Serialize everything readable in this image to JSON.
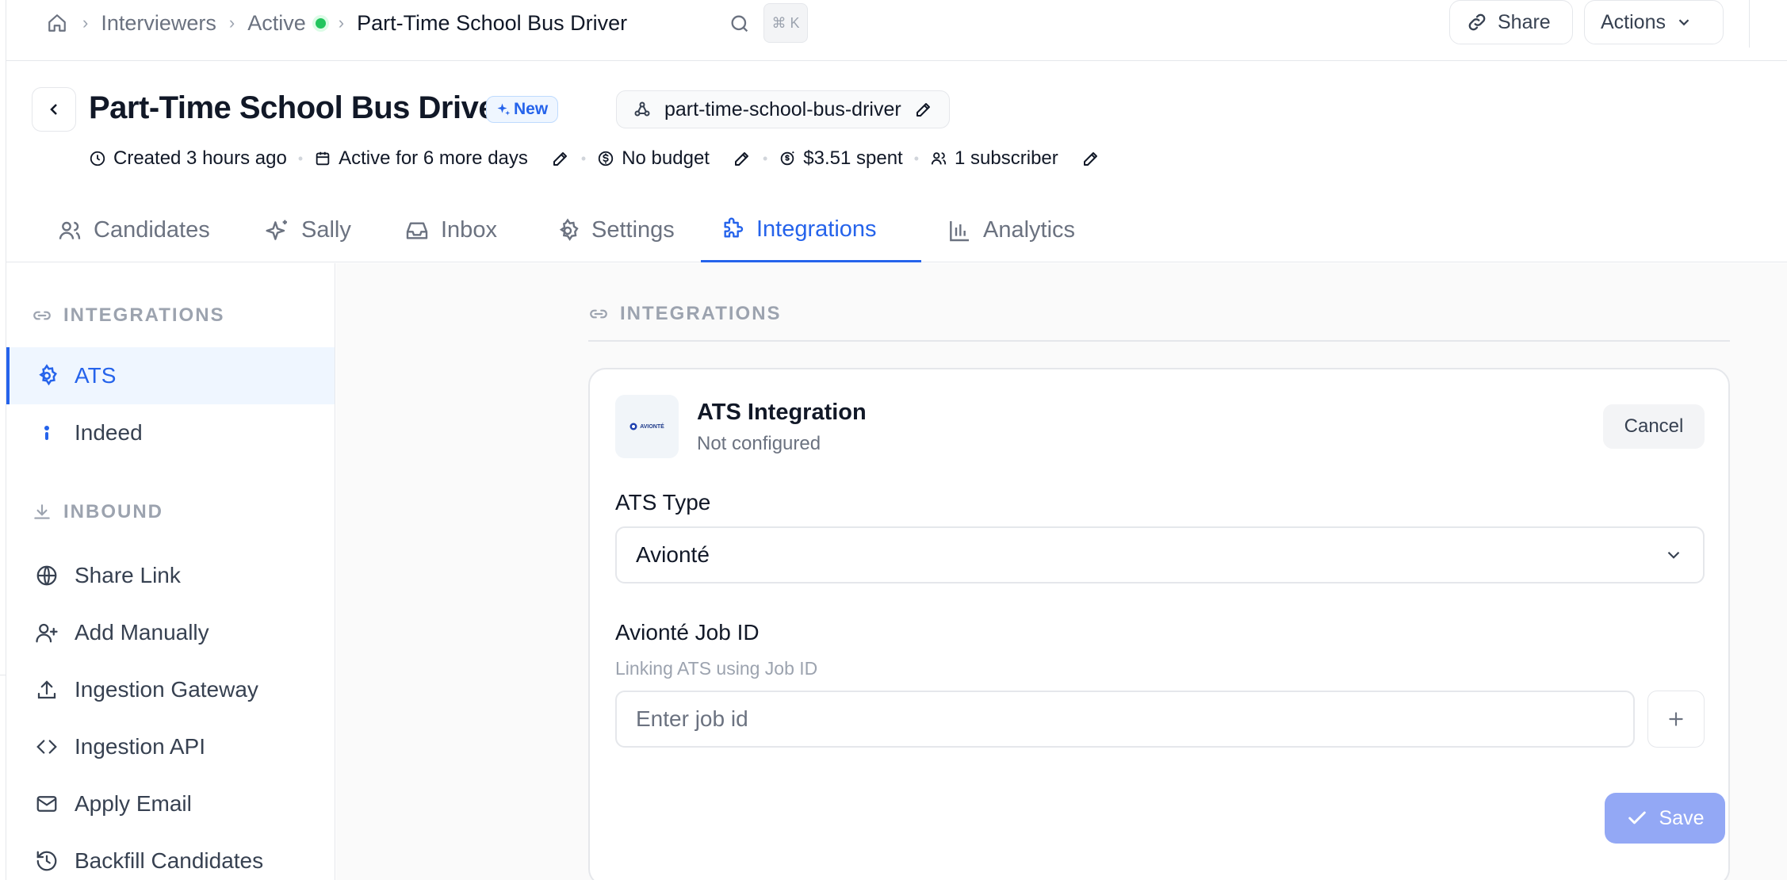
{
  "breadcrumb": {
    "items": [
      "Interviewers",
      "Active"
    ],
    "current": "Part-Time School Bus Driver",
    "shortcut": "⌘ K"
  },
  "topbar": {
    "share_label": "Share",
    "actions_label": "Actions"
  },
  "header": {
    "title": "Part-Time School Bus Driver",
    "badge": "New",
    "slug": "part-time-school-bus-driver",
    "meta": {
      "created": "Created 3 hours ago",
      "active": "Active for 6 more days",
      "budget": "No budget",
      "spent": "$3.51 spent",
      "subscribers": "1 subscriber"
    }
  },
  "tabs": [
    {
      "label": "Candidates",
      "icon": "users-icon"
    },
    {
      "label": "Sally",
      "icon": "sparkles-icon"
    },
    {
      "label": "Inbox",
      "icon": "inbox-icon"
    },
    {
      "label": "Settings",
      "icon": "gear-icon"
    },
    {
      "label": "Integrations",
      "icon": "puzzle-icon",
      "active": true
    },
    {
      "label": "Analytics",
      "icon": "bar-chart-icon"
    }
  ],
  "sidebar": {
    "integrations_heading": "INTEGRATIONS",
    "integrations_items": [
      {
        "label": "ATS",
        "icon": "gear-icon",
        "active": true
      },
      {
        "label": "Indeed",
        "icon": "indeed-icon"
      }
    ],
    "inbound_heading": "INBOUND",
    "inbound_items": [
      {
        "label": "Share Link",
        "icon": "globe-icon"
      },
      {
        "label": "Add Manually",
        "icon": "user-plus-icon"
      },
      {
        "label": "Ingestion Gateway",
        "icon": "upload-icon"
      },
      {
        "label": "Ingestion API",
        "icon": "code-icon"
      },
      {
        "label": "Apply Email",
        "icon": "mail-icon"
      },
      {
        "label": "Backfill Candidates",
        "icon": "history-icon"
      }
    ]
  },
  "main": {
    "section_heading": "INTEGRATIONS",
    "card": {
      "logo_text": "AVIONTÉ",
      "title": "ATS Integration",
      "status": "Not configured",
      "cancel_label": "Cancel",
      "ats_type_label": "ATS Type",
      "ats_type_value": "Avionté",
      "job_id_label": "Avionté Job ID",
      "job_id_hint": "Linking ATS using Job ID",
      "job_id_placeholder": "Enter job id",
      "save_label": "Save"
    }
  },
  "colors": {
    "accent": "#2563eb",
    "active_dot": "#22c55e",
    "save_disabled": "#93a8f5"
  }
}
